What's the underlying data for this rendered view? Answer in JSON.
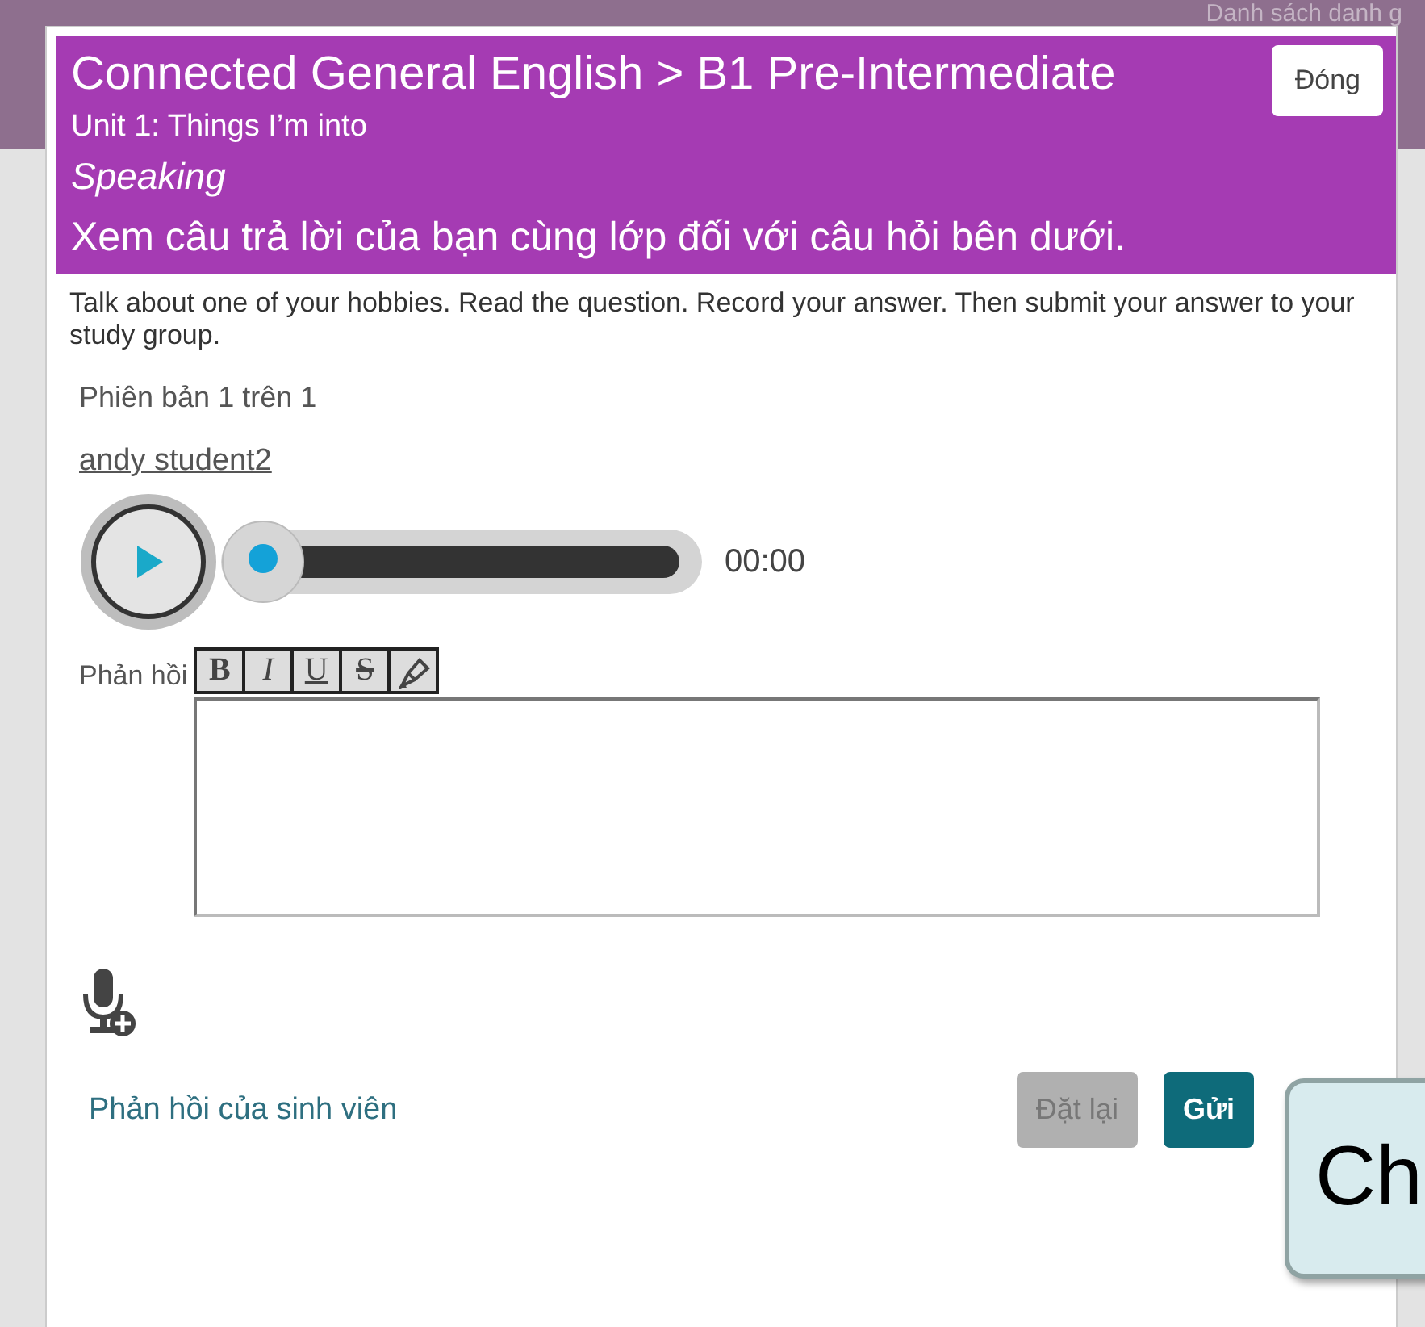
{
  "background": {
    "heading": "Danh sách danh g"
  },
  "dialog": {
    "breadcrumb": "Connected General English > B1 Pre-Intermediate",
    "unit": "Unit 1: Things I’m into",
    "skill": "Speaking",
    "instruction": "Xem câu trả lời của bạn cùng lớp đối với câu hỏi bên dưới.",
    "close_button": "Đóng",
    "prompt": "Talk about one of your hobbies. Read the question. Record your answer. Then submit your answer to your study group.",
    "version": "Phiên bản 1 trên 1",
    "student_link": "andy student2",
    "player": {
      "level": 0,
      "time": "00:00"
    },
    "feedback": {
      "label": "Phản hồi",
      "tools": [
        {
          "kind": "bold",
          "label": "B"
        },
        {
          "kind": "italic",
          "label": "I"
        },
        {
          "kind": "underline",
          "label": "U"
        },
        {
          "kind": "strike",
          "label": "S"
        },
        {
          "kind": "highlight"
        }
      ]
    },
    "feedback_link": "Phản hồi của sinh viên",
    "buttons": [
      {
        "label": "Đặt lại",
        "disabled": true
      },
      {
        "label": "Gửi",
        "disabled": false
      }
    ]
  },
  "tooltip": {
    "text": "Ch"
  }
}
